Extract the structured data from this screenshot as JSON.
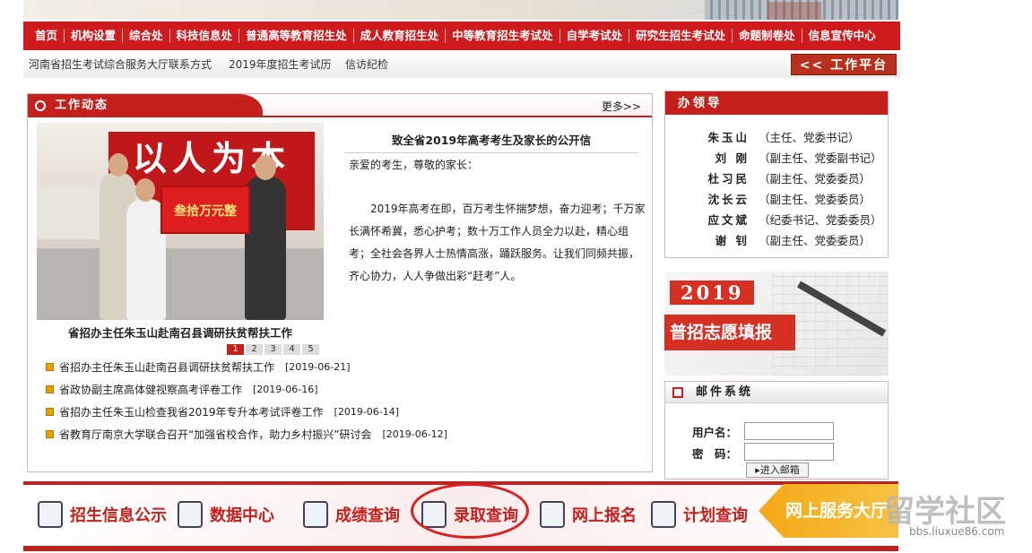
{
  "nav": [
    "首页",
    "机构设置",
    "综合处",
    "科技信息处",
    "普通高等教育招生处",
    "成人教育招生处",
    "中等教育招生考试处",
    "自学考试处",
    "研究生招生考试处",
    "命题制卷处",
    "信息宣传中心"
  ],
  "sublinks": [
    "河南省招生考试综合服务大厅联系方式",
    "2019年度招生考试历",
    "信访纪检"
  ],
  "work_platform": "<< 工作平台",
  "news_panel": {
    "title": "工作动态",
    "more": "更多>>",
    "photo_slogan": "以人为本",
    "photo_banner": "叁拾万元整",
    "caption": "省招办主任朱玉山赴南召县调研扶贫帮扶工作",
    "pages": [
      "1",
      "2",
      "3",
      "4",
      "5"
    ],
    "letter_title": "致全省2019年高考考生及家长的公开信",
    "letter_greeting": "亲爱的考生，尊敬的家长：",
    "letter_lines": [
      "2019年高考在即，百万考生怀揣梦想，奋力迎考；千万家",
      "长满怀希冀，悉心护考；数十万工作人员全力以赴，精心组",
      "考；全社会各界人士热情高涨，踊跃服务。让我们同频共振，",
      "齐心协力，人人争做出彩“赶考”人。"
    ],
    "items": [
      {
        "text": "省招办主任朱玉山赴南召县调研扶贫帮扶工作",
        "date": "[2019-06-21]"
      },
      {
        "text": "省政协副主席高体健视察高考评卷工作",
        "date": "[2019-06-16]"
      },
      {
        "text": "省招办主任朱玉山检查我省2019年专升本考试评卷工作",
        "date": "[2019-06-14]"
      },
      {
        "text": "省教育厅南京大学联合召开“加强省校合作，助力乡村振兴”研讨会",
        "date": "[2019-06-12]"
      }
    ]
  },
  "leaders": {
    "title": "办领导",
    "rows": [
      {
        "name": "朱玉山",
        "role": "（主任、党委书记）"
      },
      {
        "name": "刘 刚",
        "role": "（副主任、党委副书记）"
      },
      {
        "name": "杜习民",
        "role": "（副主任、党委委员）"
      },
      {
        "name": "沈长云",
        "role": "（副主任、党委委员）"
      },
      {
        "name": "应文斌",
        "role": "（纪委书记、党委委员）"
      },
      {
        "name": "谢 钊",
        "role": "（副主任、党委委员）"
      }
    ]
  },
  "ad": {
    "year": "2019",
    "text": "普招志愿填报"
  },
  "mail": {
    "title": "邮件系统",
    "user_label": "用户名：",
    "pwd_label": "密　码：",
    "button": "▸进入邮箱"
  },
  "services": [
    "招生信息公示",
    "数据中心",
    "成绩查询",
    "录取查询",
    "网上报名",
    "计划查询"
  ],
  "service_platform": "网上服务大厅",
  "watermark": "留学社区",
  "watermark_url": "bbs.liuxue86.com"
}
